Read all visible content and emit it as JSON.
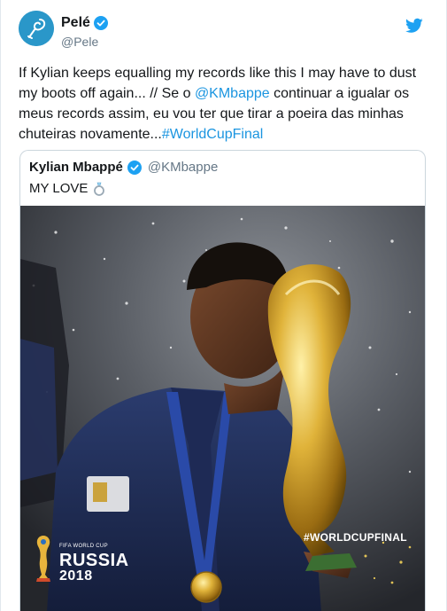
{
  "author": {
    "name": "Pelé",
    "handle": "@Pele",
    "verified": true,
    "avatar_icon": "pele-logo-icon",
    "avatar_color": "#2a97c9"
  },
  "tweet": {
    "text_part1": "If Kylian keeps equalling my records like this I may have to dust my boots off again... // Se o ",
    "mention": "@KMbappe",
    "text_part2": " continuar a igualar os meus records assim, eu vou ter que tirar a poeira das minhas chuteiras novamente...",
    "hashtag": "#WorldCupFinal"
  },
  "quoted": {
    "name": "Kylian Mbappé",
    "handle": "@KMbappe",
    "verified": true,
    "text": "MY LOVE",
    "emoji_icon": "ring-icon",
    "photo": {
      "hashtag_overlay": "#WORLDCUPFINAL",
      "logo_top": "FIFA WORLD CUP",
      "logo_country": "RUSSIA",
      "logo_year": "2018"
    }
  },
  "colors": {
    "link": "#1b95e0",
    "verified": "#1da1f2",
    "twitter_brand": "#1da1f2",
    "secondary_text": "#657786"
  }
}
